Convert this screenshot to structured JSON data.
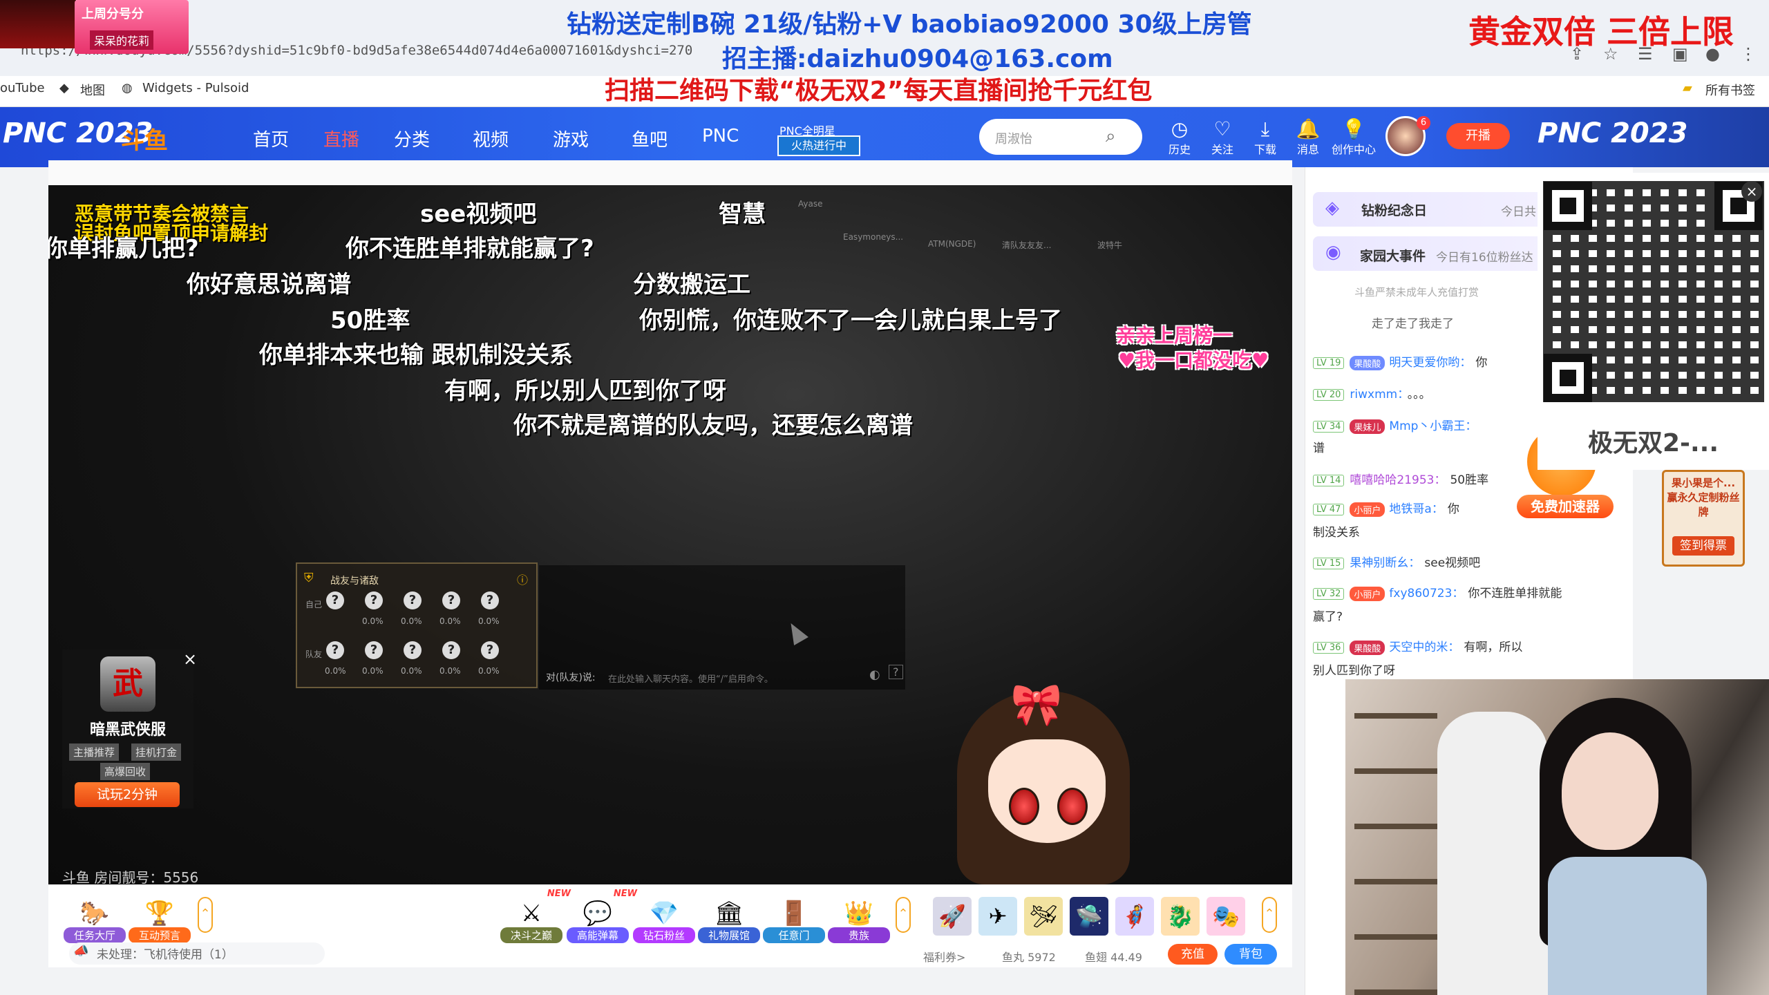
{
  "browser": {
    "url": "https://www.douyu.com/5556?dyshid=51c9bf0-bd9d5afe38e6544d074d4e6a00071601&dyshci=270",
    "bookmarks": [
      "ouTube",
      "地图",
      "Widgets - Pulsoid",
      "所有书签"
    ]
  },
  "overlay": {
    "banner1": "钻粉送定制B碗 21级/钻粉+V baobiao92000 30级上房管",
    "banner2": "招主播:daizhu0904@163.com",
    "banner3": "扫描二维码下载“极无双2”每天直播间抢千元红包",
    "banner4": "黄金双倍 三倍上限",
    "corner_gift_line1": "上周分号分",
    "corner_gift_line2": "呆呆的花莉"
  },
  "nav": {
    "pnc_left": "PNC 2023",
    "pnc_right": "PNC 2023",
    "logo": "斗鱼",
    "items": [
      "首页",
      "直播",
      "分类",
      "视频",
      "游戏",
      "鱼吧",
      "PNC"
    ],
    "star_top": "PNC全明星",
    "star_btn": "火热进行中",
    "search_placeholder": "周淑怡",
    "icons": [
      {
        "label": "历史",
        "icon": "clock-icon"
      },
      {
        "label": "关注",
        "icon": "heart-icon"
      },
      {
        "label": "下载",
        "icon": "download-icon"
      },
      {
        "label": "消息",
        "icon": "bell-icon"
      },
      {
        "label": "创作中心",
        "icon": "bulb-icon"
      }
    ],
    "avatar_badge": "6",
    "live_btn": "开播"
  },
  "video": {
    "danmu": [
      "你单排赢几把?",
      "see视频吧",
      "智慧",
      "你不连胜单排就能赢了?",
      "你好意思说离谱",
      "分数搬运工",
      "50胜率",
      "你别慌，你连败不了一会儿就白果上号了",
      "你单排本来也输 跟机制没关系",
      "有啊，所以别人匹到你了呀",
      "你不就是离谱的队友吗，还要怎么离谱"
    ],
    "warn1": "恶意带节奏会被禁言",
    "warn2": "误封鱼吧置顶申请解封",
    "pink1": "亲亲上周榜一",
    "pink2": "♥我一口都没吃♥",
    "room_number": "斗鱼 房间靓号：5556",
    "player_names": [
      "Easymoneys...",
      "ATM(NGDE)",
      "清队友友友...",
      "波特牛",
      "Ayase"
    ],
    "friend_panel": {
      "title": "战友与诸敌",
      "row_labels": [
        "自己",
        "队友"
      ],
      "pct": "0.0%"
    },
    "chat_prefix": "对(队友)说:",
    "chat_hint": "在此处输入聊天内容。使用“/”启用命令。"
  },
  "ad": {
    "title": "暗黑武侠服",
    "tags": [
      "主播推荐",
      "挂机打金",
      "高爆回收"
    ],
    "button": "试玩2分钟",
    "close": "×",
    "icon_char": "武"
  },
  "toolbar": {
    "left_items": [
      {
        "label": "任务大厅",
        "icon": "🐎",
        "color": "#8e5bd8"
      },
      {
        "label": "互动预言",
        "icon": "🏆",
        "color": "#ff6a1a"
      }
    ],
    "mid_items": [
      {
        "label": "决斗之巅",
        "icon": "⚔",
        "color": "#6f7b3a",
        "new": "NEW"
      },
      {
        "label": "高能弹幕",
        "icon": "💬",
        "color": "#6a5cff",
        "new": "NEW"
      },
      {
        "label": "钻石粉丝",
        "icon": "💎",
        "color": "#b33aff",
        "new": ""
      },
      {
        "label": "礼物展馆",
        "icon": "🏛",
        "color": "#3a63d6",
        "new": ""
      },
      {
        "label": "任意门",
        "icon": "🚪",
        "color": "#2a8fd6",
        "new": ""
      },
      {
        "label": "贵族",
        "icon": "👑",
        "color": "#8a3ad6",
        "new": ""
      }
    ],
    "gifts": [
      "🚀",
      "✈",
      "🛩",
      "🛸",
      "🦸",
      "🐉",
      "🎭"
    ],
    "pending": "未处理：飞机待使用（1）",
    "coupon": "福利券>",
    "fish_pill": "鱼丸 5972",
    "fish_fin": "鱼翅 44.49",
    "recharge": "充值",
    "bag": "背包"
  },
  "chat": {
    "events": [
      {
        "title": "钻粉纪念日",
        "sub": "今日共"
      },
      {
        "title": "家园大事件",
        "sub": "今日有16位粉丝达"
      }
    ],
    "notice": "斗鱼严禁未成年人充值打赏",
    "first": "走了走了我走了",
    "messages": [
      {
        "lv": "LV 19",
        "badge": "果酸酸",
        "name": "明天更爱你哟：",
        "text": "你"
      },
      {
        "lv": "LV 20",
        "badge": "",
        "name": "riwxmm：",
        "text": "。。。"
      },
      {
        "lv": "LV 34",
        "badge": "果妹儿",
        "name": "Mmp丶小霸王：",
        "text": ""
      },
      {
        "lv": "",
        "badge": "",
        "name": "",
        "text": "谱"
      },
      {
        "lv": "LV 14",
        "badge": "",
        "name": "嘻嘻哈哈21953：",
        "text": "50胜率"
      },
      {
        "lv": "LV 47",
        "badge": "小丽户",
        "name": "地铁哥a：",
        "text": "你"
      },
      {
        "lv": "",
        "badge": "",
        "name": "",
        "text": "制没关系"
      },
      {
        "lv": "LV 15",
        "badge": "",
        "name": "果神别断幺：",
        "text": "see视频吧"
      },
      {
        "lv": "LV 32",
        "badge": "小丽户",
        "name": "fxy860723：",
        "text": "你不连胜单排就能"
      },
      {
        "lv": "",
        "badge": "",
        "name": "",
        "text": "赢了?"
      },
      {
        "lv": "LV 36",
        "badge": "果酸酸",
        "name": "天空中的米：",
        "text": "有啊，所以"
      },
      {
        "lv": "",
        "badge": "",
        "name": "",
        "text": "别人匹到你了呀"
      }
    ],
    "accel": "免费加速器",
    "fan_sign": "果小果是个... 赢永久定制粉丝牌",
    "fan_sign_btn": "签到得票"
  },
  "qr": {
    "title": "极无双2-...",
    "close": "×"
  }
}
